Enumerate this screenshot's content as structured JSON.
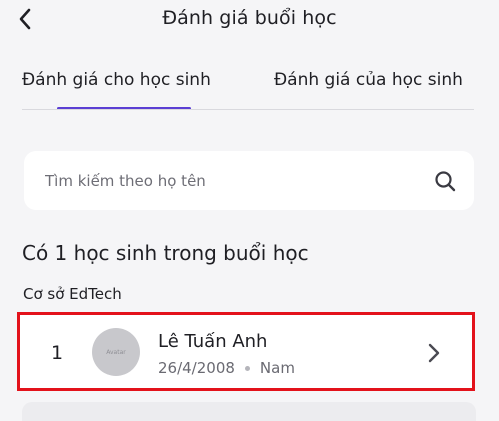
{
  "header": {
    "title": "Đánh giá buổi học",
    "back_icon": "chevron-left-icon"
  },
  "tabs": [
    {
      "label": "Đánh giá cho học sinh",
      "active": true
    },
    {
      "label": "Đánh giá của học sinh",
      "active": false
    }
  ],
  "colors": {
    "accent": "#5b3fd4",
    "highlight_border": "#e3121b",
    "background": "#f5f5f7"
  },
  "search": {
    "placeholder": "Tìm kiếm theo họ tên",
    "value": "",
    "icon": "search-icon"
  },
  "summary": {
    "heading": "Có 1 học sinh trong buổi học",
    "branch": "Cơ sở EdTech"
  },
  "students": [
    {
      "index": "1",
      "avatar_text": "Avatar",
      "name": "Lê Tuấn Anh",
      "dob": "26/4/2008",
      "gender": "Nam"
    }
  ]
}
